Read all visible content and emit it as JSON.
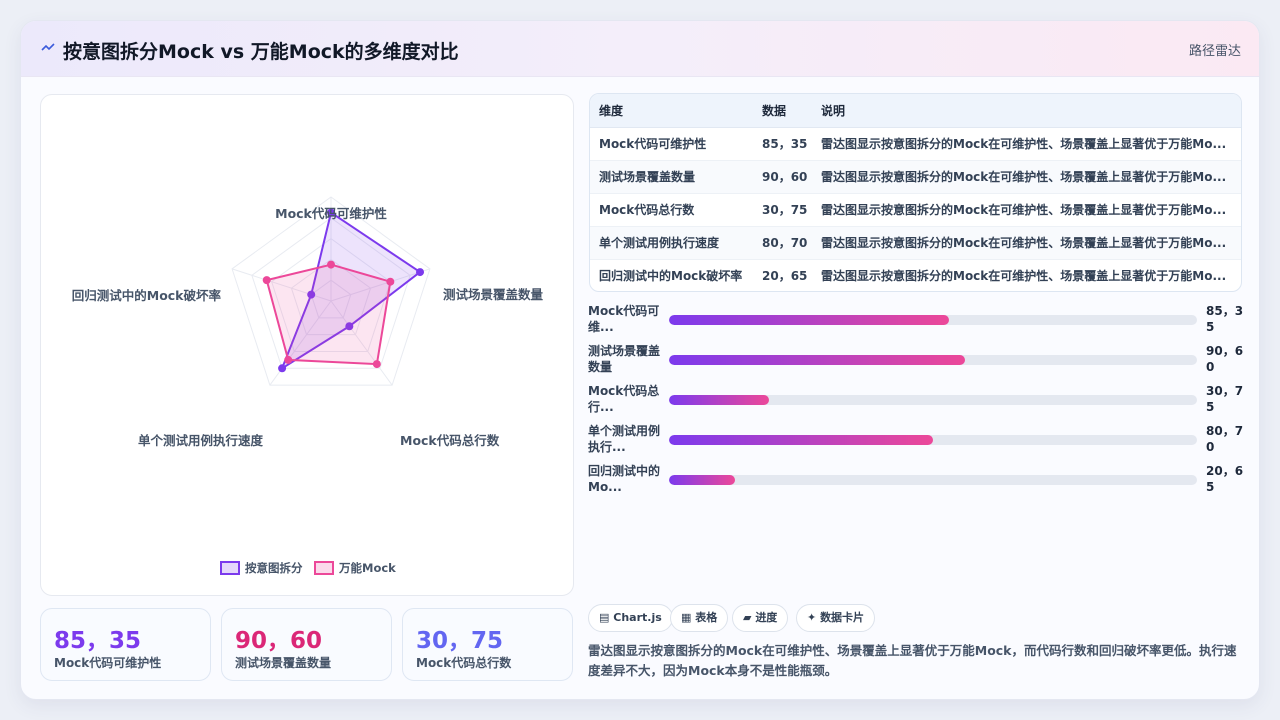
{
  "header": {
    "title": "按意图拆分Mock vs 万能Mock的多维度对比",
    "right_label": "路径雷达"
  },
  "colors": {
    "series1": "#7c3aed",
    "series2": "#ec4899",
    "stat_colors": [
      "#7c3aed",
      "#db2777",
      "#6366f1"
    ]
  },
  "chart_data": {
    "type": "radar",
    "categories": [
      "Mock代码可维护性",
      "测试场景覆盖数量",
      "Mock代码总行数",
      "单个测试用例执行速度",
      "回归测试中的Mock破坏率"
    ],
    "series": [
      {
        "name": "按意图拆分",
        "values": [
          85,
          90,
          30,
          80,
          20
        ]
      },
      {
        "name": "万能Mock",
        "values": [
          35,
          60,
          75,
          70,
          65
        ]
      }
    ],
    "rlim": [
      0,
      100
    ],
    "grid": true,
    "legend": "bottom"
  },
  "table": {
    "headers": [
      "维度",
      "数据",
      "说明"
    ],
    "rows": [
      [
        "Mock代码可维护性",
        "85，35",
        "雷达图显示按意图拆分的Mock在可维护性、场景覆盖上显著优于万能Mo..."
      ],
      [
        "测试场景覆盖数量",
        "90，60",
        "雷达图显示按意图拆分的Mock在可维护性、场景覆盖上显著优于万能Mo..."
      ],
      [
        "Mock代码总行数",
        "30，75",
        "雷达图显示按意图拆分的Mock在可维护性、场景覆盖上显著优于万能Mo..."
      ],
      [
        "单个测试用例执行速度",
        "80，70",
        "雷达图显示按意图拆分的Mock在可维护性、场景覆盖上显著优于万能Mo..."
      ],
      [
        "回归测试中的Mock破坏率",
        "20，65",
        "雷达图显示按意图拆分的Mock在可维护性、场景覆盖上显著优于万能Mo..."
      ]
    ]
  },
  "progress": [
    {
      "label": "Mock代码可维...",
      "value": "85，35",
      "fill": 0.53
    },
    {
      "label": "测试场景覆盖数量",
      "value": "90，60",
      "fill": 0.56
    },
    {
      "label": "Mock代码总行...",
      "value": "30，75",
      "fill": 0.19
    },
    {
      "label": "单个测试用例执行...",
      "value": "80，70",
      "fill": 0.5
    },
    {
      "label": "回归测试中的Mo...",
      "value": "20，65",
      "fill": 0.125
    }
  ],
  "stats": [
    {
      "value": "85，35",
      "label": "Mock代码可维护性"
    },
    {
      "value": "90，60",
      "label": "测试场景覆盖数量"
    },
    {
      "value": "30，75",
      "label": "Mock代码总行数"
    }
  ],
  "tags": [
    {
      "icon": "chart-icon",
      "glyph": "▤",
      "label": "Chart.js"
    },
    {
      "icon": "table-icon",
      "glyph": "▦",
      "label": "表格"
    },
    {
      "icon": "progress-icon",
      "glyph": "▰",
      "label": "进度"
    },
    {
      "icon": "card-icon",
      "glyph": "✦",
      "label": "数据卡片"
    }
  ],
  "summary": "雷达图显示按意图拆分的Mock在可维护性、场景覆盖上显著优于万能Mock，而代码行数和回归破坏率更低。执行速度差异不大，因为Mock本身不是性能瓶颈。"
}
